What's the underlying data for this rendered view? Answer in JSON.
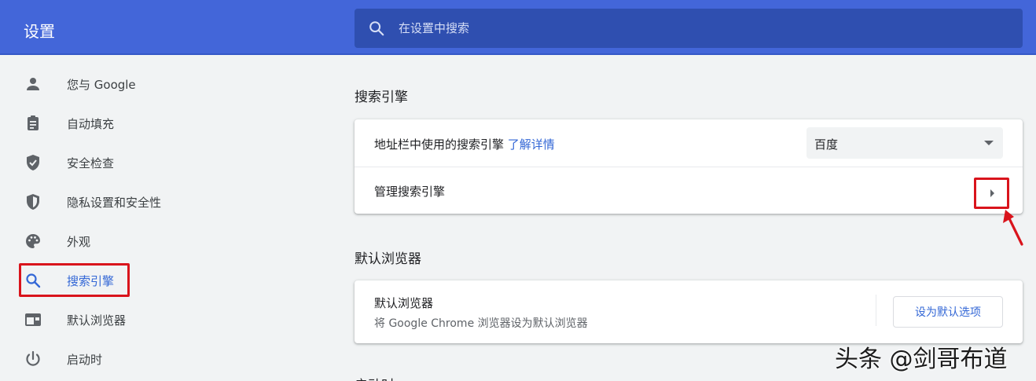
{
  "header": {
    "title": "设置",
    "search_placeholder": "在设置中搜索"
  },
  "sidebar": {
    "items": [
      {
        "label": "您与 Google",
        "icon": "person-icon"
      },
      {
        "label": "自动填充",
        "icon": "clipboard-icon"
      },
      {
        "label": "安全检查",
        "icon": "shield-check-icon"
      },
      {
        "label": "隐私设置和安全性",
        "icon": "shield-half-icon"
      },
      {
        "label": "外观",
        "icon": "palette-icon"
      },
      {
        "label": "搜索引擎",
        "icon": "search-icon",
        "active": true
      },
      {
        "label": "默认浏览器",
        "icon": "browser-window-icon"
      },
      {
        "label": "启动时",
        "icon": "power-icon"
      }
    ]
  },
  "search_engine_section": {
    "title": "搜索引擎",
    "address_bar_label": "地址栏中使用的搜索引擎",
    "learn_more": "了解详情",
    "selected_engine": "百度",
    "manage_label": "管理搜索引擎"
  },
  "default_browser_section": {
    "title": "默认浏览器",
    "row_title": "默认浏览器",
    "row_subtitle": "将 Google Chrome 浏览器设为默认浏览器",
    "button_label": "设为默认选项"
  },
  "next_section_title": "启动时",
  "watermark": "头条 @剑哥布道",
  "colors": {
    "header_bg": "#4366d9",
    "search_bg": "#2f4fb0",
    "accent": "#3367d6",
    "highlight_red": "#d9141c"
  }
}
